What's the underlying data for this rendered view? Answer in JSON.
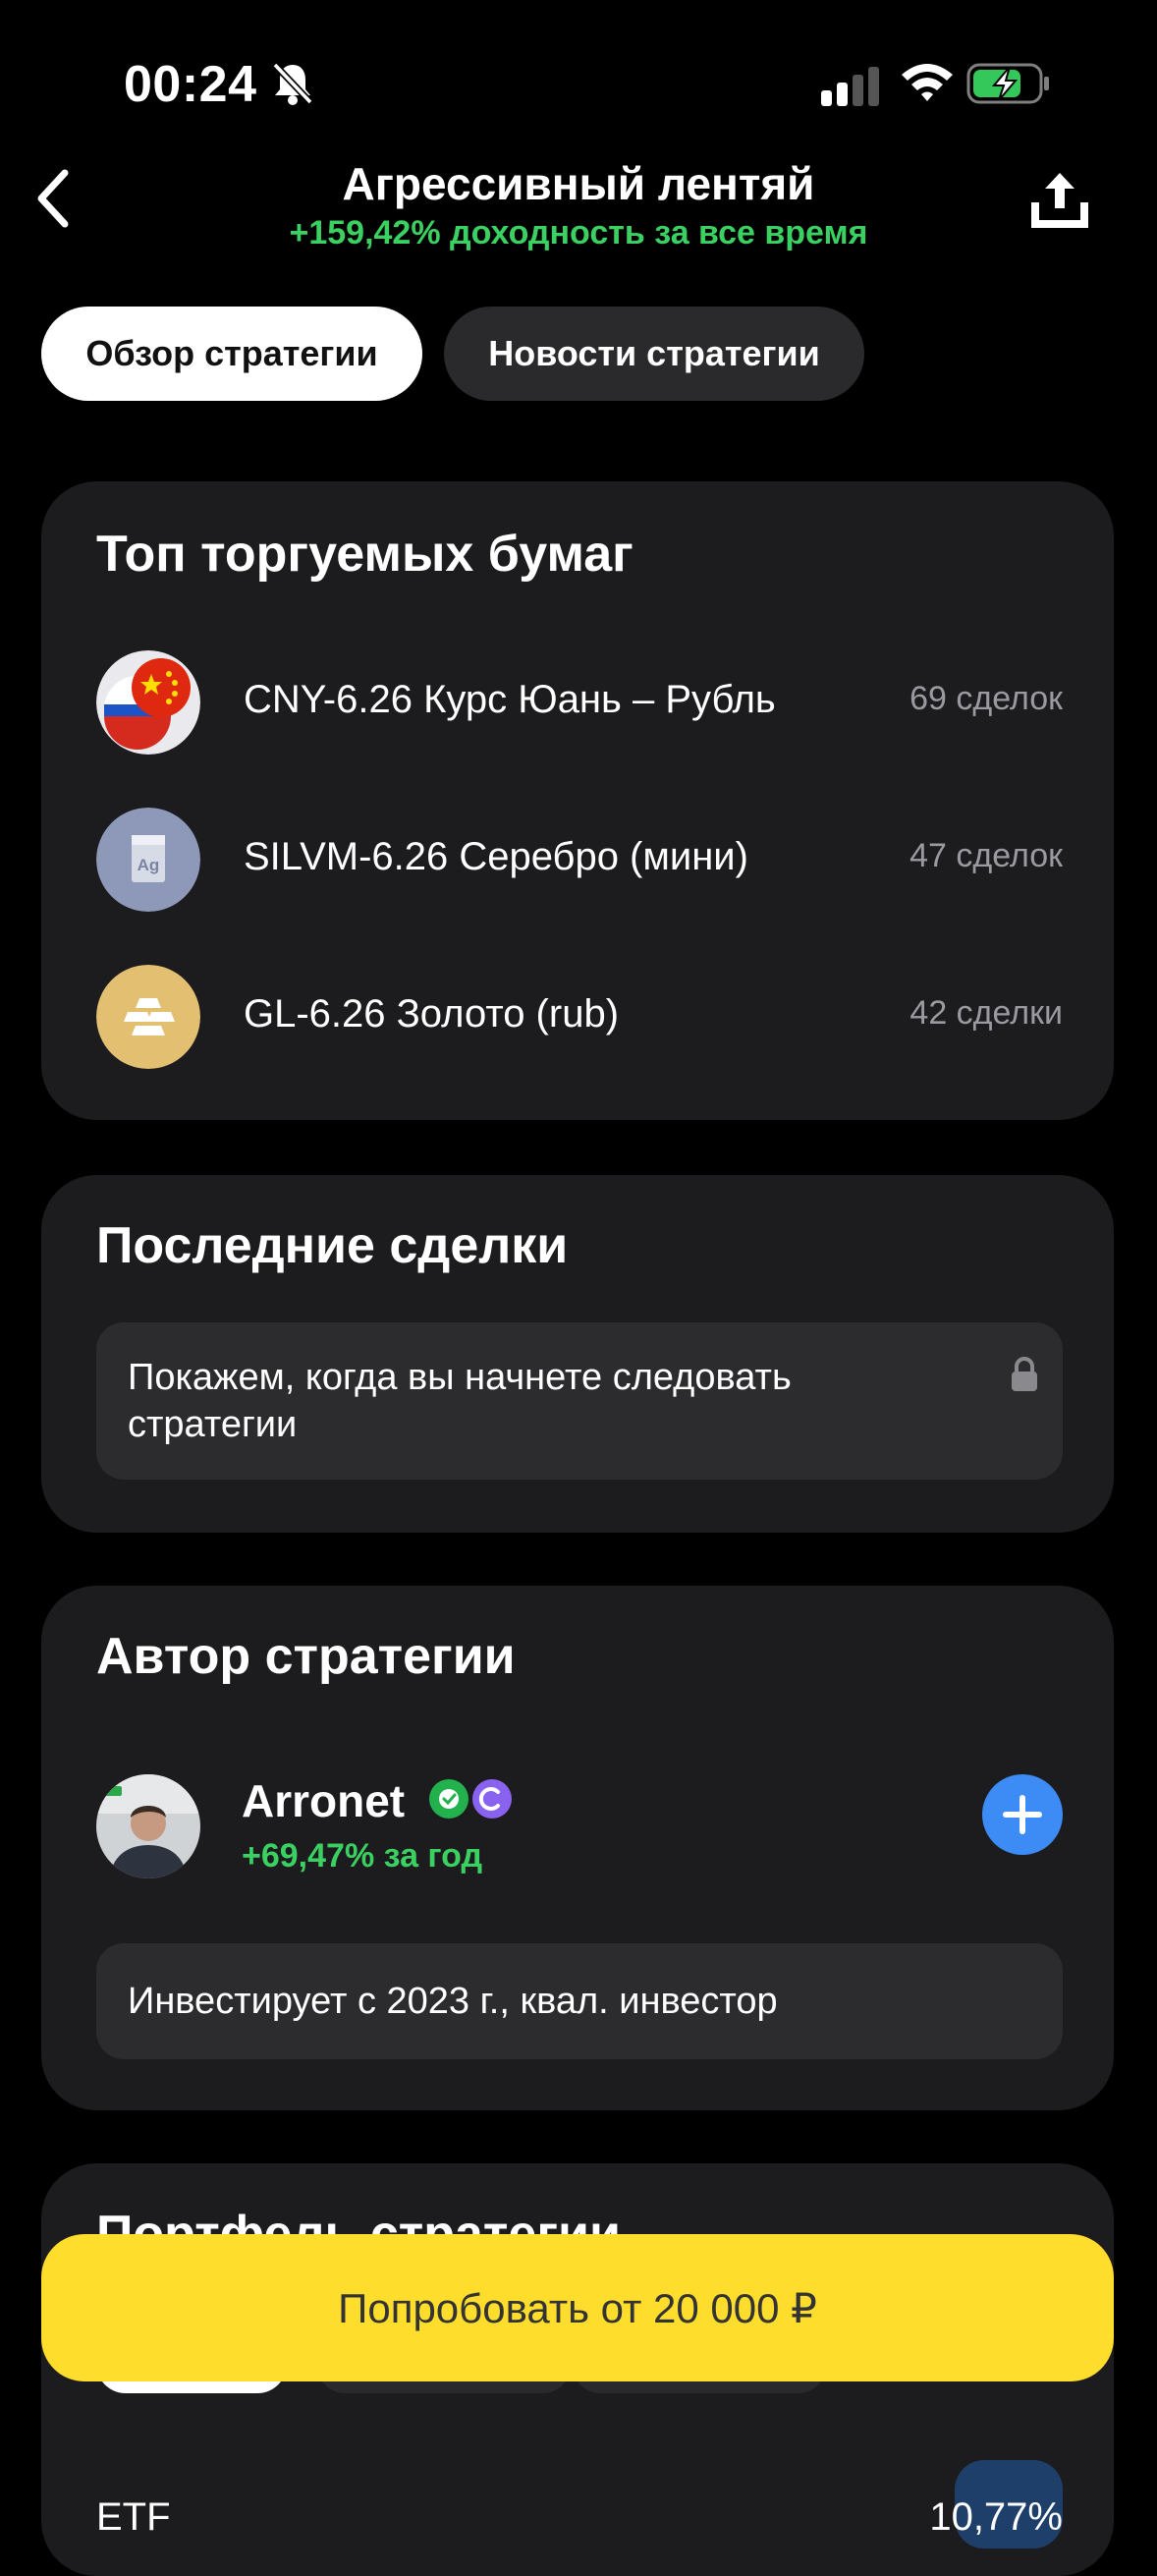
{
  "status_bar": {
    "time": "00:24"
  },
  "header": {
    "title": "Агрессивный лентяй",
    "subtitle": "+159,42% доходность за все время"
  },
  "tabs": [
    {
      "label": "Обзор стратегии",
      "active": true
    },
    {
      "label": "Новости стратегии",
      "active": false
    }
  ],
  "top_securities": {
    "title": "Топ торгуемых бумаг",
    "items": [
      {
        "name": "CNY-6.26 Курс Юань – Рубль",
        "count": "69 сделок",
        "icon": "cny-rub-flag-icon"
      },
      {
        "name": "SILVM-6.26 Серебро (мини)",
        "count": "47 сделок",
        "icon": "silver-ag-icon"
      },
      {
        "name": "GL-6.26 Золото (rub)",
        "count": "42 сделки",
        "icon": "gold-bars-icon"
      }
    ]
  },
  "recent_deals": {
    "title": "Последние сделки",
    "locked_message": "Покажем, когда вы начнете следовать стратегии"
  },
  "author": {
    "title": "Автор стратегии",
    "name": "Arronet",
    "return": "+69,47% за год",
    "bio": "Инвестирует с 2023 г., квал. инвестор"
  },
  "portfolio": {
    "title_partial": "Портфель стратегии",
    "row_label_partial": "ETF",
    "row_value_partial": "10,77%"
  },
  "cta": {
    "label": "Попробовать от 20 000 ₽"
  },
  "colors": {
    "background": "#000000",
    "card": "#1c1c1e",
    "accent_green": "#3ad062",
    "cta_yellow": "#fedd2c",
    "plus_blue": "#3d8cf5"
  }
}
